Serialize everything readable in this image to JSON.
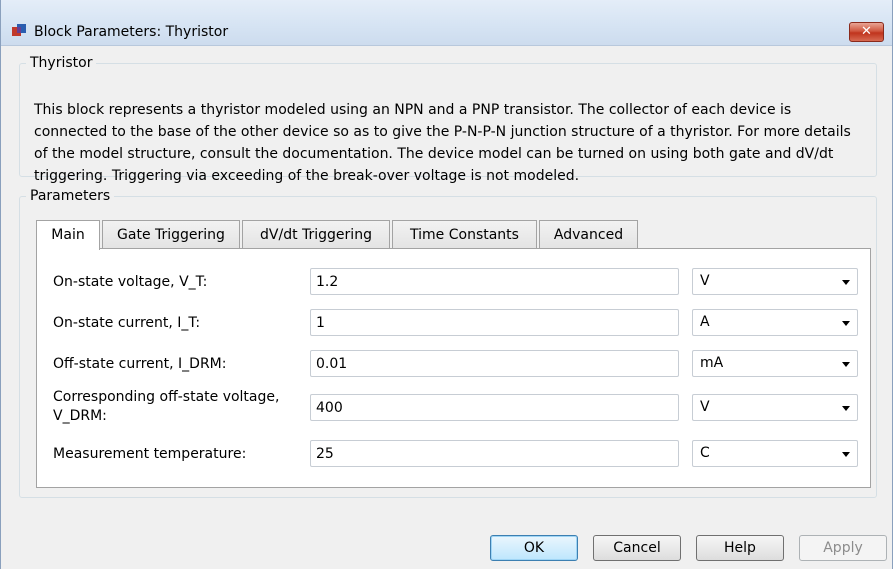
{
  "window": {
    "title": "Block Parameters: Thyristor",
    "close_glyph": "✕"
  },
  "description": {
    "group_title": "Thyristor",
    "text": "This block represents a thyristor modeled using an NPN and a PNP transistor. The collector of each device is connected to the base of the other device so as to give the P-N-P-N junction structure of a thyristor. For more details of the model structure, consult the documentation. The device model can be turned on using both gate and dV/dt triggering. Triggering via exceeding of the break-over voltage is not modeled."
  },
  "parameters": {
    "group_title": "Parameters",
    "tabs": [
      {
        "label": "Main",
        "active": true
      },
      {
        "label": "Gate Triggering",
        "active": false
      },
      {
        "label": "dV/dt Triggering",
        "active": false
      },
      {
        "label": "Time Constants",
        "active": false
      },
      {
        "label": "Advanced",
        "active": false
      }
    ],
    "rows": [
      {
        "label": "On-state voltage, V_T:",
        "value": "1.2",
        "unit": "V"
      },
      {
        "label": "On-state current, I_T:",
        "value": "1",
        "unit": "A"
      },
      {
        "label": "Off-state current, I_DRM:",
        "value": "0.01",
        "unit": "mA"
      },
      {
        "label_line1": "Corresponding off-state voltage,",
        "label_line2": "V_DRM:",
        "value": "400",
        "unit": "V"
      },
      {
        "label": "Measurement temperature:",
        "value": "25",
        "unit": "C"
      }
    ]
  },
  "buttons": {
    "ok": "OK",
    "cancel": "Cancel",
    "help": "Help",
    "apply": "Apply"
  },
  "colors": {
    "titlebar": "#d5e3f3",
    "close_button": "#c0341d",
    "dialog_background": "#f0f0f0"
  }
}
